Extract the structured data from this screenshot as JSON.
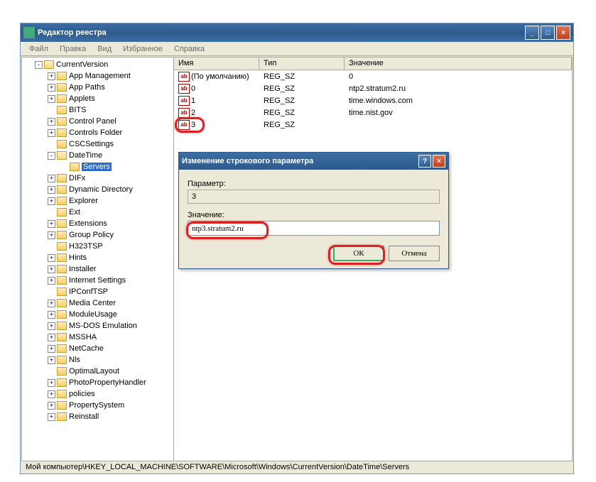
{
  "window": {
    "title": "Редактор реестра"
  },
  "menu": {
    "items": [
      "Файл",
      "Правка",
      "Вид",
      "Избранное",
      "Справка"
    ]
  },
  "tree": {
    "root": "CurrentVersion",
    "items": [
      {
        "label": "App Management",
        "exp": "+",
        "indent": 2
      },
      {
        "label": "App Paths",
        "exp": "+",
        "indent": 2
      },
      {
        "label": "Applets",
        "exp": "+",
        "indent": 2
      },
      {
        "label": "BITS",
        "exp": "",
        "indent": 2
      },
      {
        "label": "Control Panel",
        "exp": "+",
        "indent": 2
      },
      {
        "label": "Controls Folder",
        "exp": "+",
        "indent": 2
      },
      {
        "label": "CSCSettings",
        "exp": "",
        "indent": 2
      },
      {
        "label": "DateTime",
        "exp": "-",
        "indent": 2,
        "open": true
      },
      {
        "label": "Servers",
        "exp": "",
        "indent": 3,
        "selected": true
      },
      {
        "label": "DIFx",
        "exp": "+",
        "indent": 2
      },
      {
        "label": "Dynamic Directory",
        "exp": "+",
        "indent": 2
      },
      {
        "label": "Explorer",
        "exp": "+",
        "indent": 2
      },
      {
        "label": "Ext",
        "exp": "",
        "indent": 2
      },
      {
        "label": "Extensions",
        "exp": "+",
        "indent": 2
      },
      {
        "label": "Group Policy",
        "exp": "+",
        "indent": 2
      },
      {
        "label": "H323TSP",
        "exp": "",
        "indent": 2
      },
      {
        "label": "Hints",
        "exp": "+",
        "indent": 2
      },
      {
        "label": "Installer",
        "exp": "+",
        "indent": 2
      },
      {
        "label": "Internet Settings",
        "exp": "+",
        "indent": 2
      },
      {
        "label": "IPConfTSP",
        "exp": "",
        "indent": 2
      },
      {
        "label": "Media Center",
        "exp": "+",
        "indent": 2
      },
      {
        "label": "ModuleUsage",
        "exp": "+",
        "indent": 2
      },
      {
        "label": "MS-DOS Emulation",
        "exp": "+",
        "indent": 2
      },
      {
        "label": "MSSHA",
        "exp": "+",
        "indent": 2
      },
      {
        "label": "NetCache",
        "exp": "+",
        "indent": 2
      },
      {
        "label": "Nls",
        "exp": "+",
        "indent": 2
      },
      {
        "label": "OptimalLayout",
        "exp": "",
        "indent": 2
      },
      {
        "label": "PhotoPropertyHandler",
        "exp": "+",
        "indent": 2
      },
      {
        "label": "policies",
        "exp": "+",
        "indent": 2
      },
      {
        "label": "PropertySystem",
        "exp": "+",
        "indent": 2
      },
      {
        "label": "Reinstall",
        "exp": "+",
        "indent": 2
      }
    ]
  },
  "list": {
    "headers": {
      "name": "Имя",
      "type": "Тип",
      "value": "Значение"
    },
    "rows": [
      {
        "name": "(По умолчанию)",
        "type": "REG_SZ",
        "value": "0"
      },
      {
        "name": "0",
        "type": "REG_SZ",
        "value": "ntp2.stratum2.ru"
      },
      {
        "name": "1",
        "type": "REG_SZ",
        "value": "time.windows.com"
      },
      {
        "name": "2",
        "type": "REG_SZ",
        "value": "time.nist.gov"
      },
      {
        "name": "3",
        "type": "REG_SZ",
        "value": ""
      }
    ]
  },
  "dialog": {
    "title": "Изменение строкового параметра",
    "param_label": "Параметр:",
    "param_value": "3",
    "value_label": "Значение:",
    "value_value": "ntp3.stratum2.ru",
    "ok": "ОК",
    "cancel": "Отмена"
  },
  "statusbar": "Мой компьютер\\HKEY_LOCAL_MACHINE\\SOFTWARE\\Microsoft\\Windows\\CurrentVersion\\DateTime\\Servers"
}
